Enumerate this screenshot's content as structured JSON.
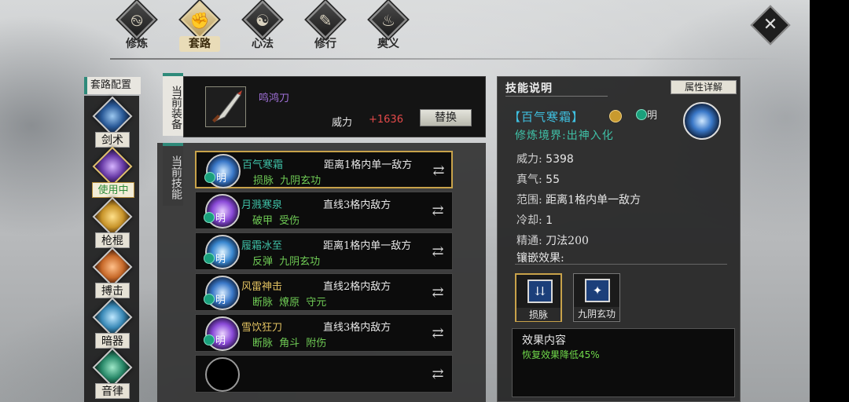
{
  "nav": {
    "tabs": [
      {
        "label": "修炼",
        "icon": "swirl-icon"
      },
      {
        "label": "套路",
        "icon": "fist-icon"
      },
      {
        "label": "心法",
        "icon": "taiji-icon"
      },
      {
        "label": "修行",
        "icon": "scroll-icon"
      },
      {
        "label": "奥义",
        "icon": "flame-icon"
      }
    ],
    "active_tab": "套路"
  },
  "left": {
    "header": "套路配置",
    "categories": [
      {
        "label": "剑术",
        "color": "#3b6fb0"
      },
      {
        "label": "使用中",
        "color": "#6a3ca8"
      },
      {
        "label": "枪棍",
        "color": "#c8942a"
      },
      {
        "label": "搏击",
        "color": "#c86a2a"
      },
      {
        "label": "暗器",
        "color": "#3a8ab8"
      },
      {
        "label": "音律",
        "color": "#2a8a6a"
      }
    ]
  },
  "equipment": {
    "tag": "当前装备",
    "name": "鸣鸿刀",
    "power_label": "威力",
    "power_value": "+1636",
    "replace_label": "替换"
  },
  "skills": {
    "tag": "当前技能",
    "rows": [
      {
        "name": "百气寒霜",
        "range": "距离1格内单一敌方",
        "tags": "损脉 九阴玄功",
        "badge": "明",
        "color": "#3a78c8",
        "selected": true
      },
      {
        "name": "月溅寒泉",
        "range": "直线3格内敌方",
        "tags": "破甲 受伤",
        "badge": "明",
        "color": "#8a4ad8",
        "selected": false
      },
      {
        "name": "履霜冰至",
        "range": "距离1格内单一敌方",
        "tags": "反弹 九阴玄功",
        "badge": "明",
        "color": "#3a88d0",
        "selected": false
      },
      {
        "name": "风雷神击",
        "range": "直线2格内敌方",
        "tags": "断脉 燎原 守元",
        "badge": "明",
        "color": "#3a78c8",
        "selected": false
      },
      {
        "name": "雪饮狂刀",
        "range": "直线3格内敌方",
        "tags": "断脉 角斗 附伤",
        "badge": "明",
        "color": "#8a4ad8",
        "selected": false
      },
      {
        "name": "",
        "range": "",
        "tags": "",
        "badge": "",
        "color": "#000000",
        "selected": false
      }
    ]
  },
  "detail": {
    "title": "技能说明",
    "attr_button": "属性详解",
    "skill_title": "【百气寒霜】",
    "badge": "明",
    "realm": "修炼境界:出神入化",
    "stats": [
      {
        "k": "威力:",
        "v": "5398"
      },
      {
        "k": "真气:",
        "v": "55"
      },
      {
        "k": "范围:",
        "v": "距离1格内单一敌方"
      },
      {
        "k": "冷却:",
        "v": "1"
      },
      {
        "k": "精通:",
        "v": "刀法200"
      }
    ],
    "inlay_label": "镶嵌效果:",
    "inlays": [
      {
        "name": "损脉",
        "glyph": "⇊"
      },
      {
        "name": "九阴玄功",
        "glyph": "✦"
      }
    ],
    "effect_title": "效果内容",
    "effect_text": "恢复效果降低45%"
  }
}
